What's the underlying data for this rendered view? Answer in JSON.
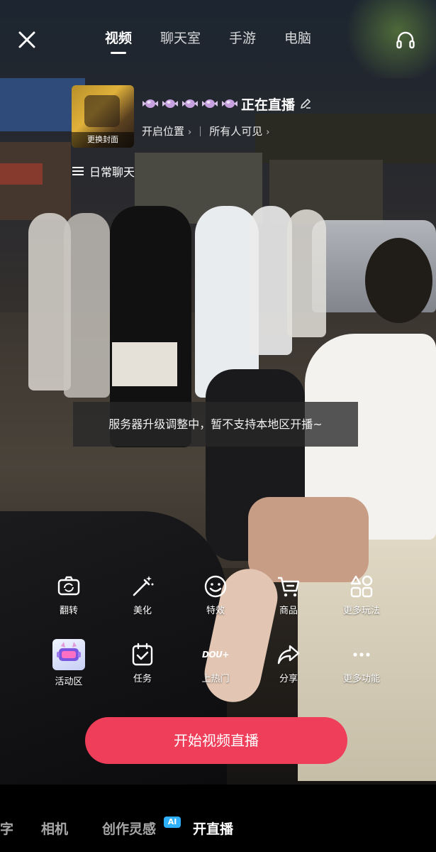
{
  "top_tabs": [
    {
      "label": "视频",
      "active": true
    },
    {
      "label": "聊天室",
      "active": false
    },
    {
      "label": "手游",
      "active": false
    },
    {
      "label": "电脑",
      "active": false
    }
  ],
  "stream": {
    "cover_label": "更换封面",
    "title": "正在直播",
    "location_label": "开启位置",
    "visibility_label": "所有人可见",
    "category_label": "日常聊天"
  },
  "toast": "服务器升级调整中，暂不支持本地区开播~",
  "tools_row1": [
    {
      "label": "翻转",
      "icon": "flip-camera-icon"
    },
    {
      "label": "美化",
      "icon": "magic-wand-icon"
    },
    {
      "label": "特效",
      "icon": "smiley-icon"
    },
    {
      "label": "商品",
      "icon": "shopping-cart-icon"
    },
    {
      "label": "更多玩法",
      "icon": "grid-apps-icon"
    }
  ],
  "tools_row2": [
    {
      "label": "活动区",
      "icon": "activity-badge-icon"
    },
    {
      "label": "任务",
      "icon": "task-check-icon"
    },
    {
      "label": "上热门",
      "icon": "dou-plus-icon",
      "icon_text": "DOU+"
    },
    {
      "label": "分享",
      "icon": "share-arrow-icon"
    },
    {
      "label": "更多功能",
      "icon": "more-dots-icon"
    }
  ],
  "start_button": "开始视频直播",
  "bottom_modes": [
    {
      "label": "字",
      "active": false
    },
    {
      "label": "相机",
      "active": false
    },
    {
      "label": "创作灵感",
      "active": false,
      "badge": "AI"
    },
    {
      "label": "开直播",
      "active": true
    }
  ],
  "colors": {
    "start_button": "#ee3e5a",
    "ai_badge": "#2fb0ff",
    "toast_bg": "rgba(40,40,40,0.78)"
  }
}
